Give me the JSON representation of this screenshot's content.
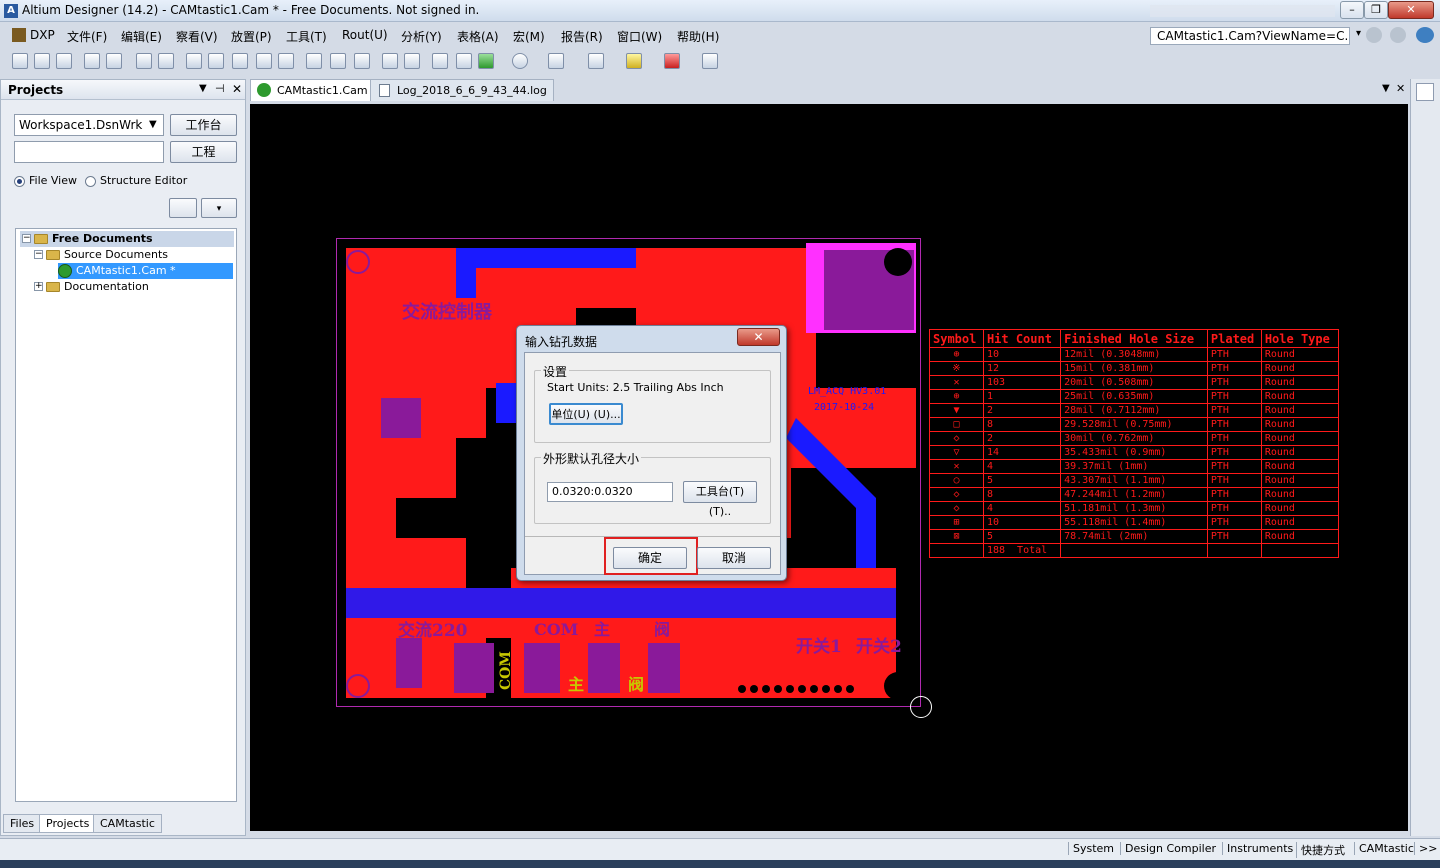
{
  "window": {
    "title": "Altium Designer (14.2) - CAMtastic1.Cam * - Free Documents. Not signed in."
  },
  "menu": [
    "DXP",
    "文件(F)",
    "编辑(E)",
    "察看(V)",
    "放置(P)",
    "工具(T)",
    "Rout(U)",
    "分析(Y)",
    "表格(A)",
    "宏(M)",
    "报告(R)",
    "窗口(W)",
    "帮助(H)"
  ],
  "address": {
    "value": "CAMtastic1.Cam?ViewName=C..."
  },
  "panel": {
    "title": "Projects",
    "workspace": "Workspace1.DsnWrk",
    "workspace_btn": "工作台",
    "project_btn": "工程",
    "radio_file_view": "File View",
    "radio_structure": "Structure Editor",
    "tree": {
      "root": "Free Documents",
      "source": "Source Documents",
      "file": "CAMtastic1.Cam *",
      "docs": "Documentation"
    },
    "tabs": [
      "Files",
      "Projects",
      "CAMtastic"
    ]
  },
  "doctabs": [
    "CAMtastic1.Cam *",
    "Log_2018_6_6_9_43_44.log"
  ],
  "drill_table": {
    "headers": [
      "Symbol",
      "Hit Count",
      "Finished Hole Size",
      "Plated",
      "Hole Type"
    ],
    "rows": [
      [
        "⊕",
        "10",
        "12mil (0.3048mm)",
        "PTH",
        "Round"
      ],
      [
        "※",
        "12",
        "15mil (0.381mm)",
        "PTH",
        "Round"
      ],
      [
        "✕",
        "103",
        "20mil (0.508mm)",
        "PTH",
        "Round"
      ],
      [
        "⊕",
        "1",
        "25mil (0.635mm)",
        "PTH",
        "Round"
      ],
      [
        "▼",
        "2",
        "28mil (0.7112mm)",
        "PTH",
        "Round"
      ],
      [
        "□",
        "8",
        "29.528mil (0.75mm)",
        "PTH",
        "Round"
      ],
      [
        "◇",
        "2",
        "30mil (0.762mm)",
        "PTH",
        "Round"
      ],
      [
        "▽",
        "14",
        "35.433mil (0.9mm)",
        "PTH",
        "Round"
      ],
      [
        "✕",
        "4",
        "39.37mil (1mm)",
        "PTH",
        "Round"
      ],
      [
        "○",
        "5",
        "43.307mil (1.1mm)",
        "PTH",
        "Round"
      ],
      [
        "◇",
        "8",
        "47.244mil (1.2mm)",
        "PTH",
        "Round"
      ],
      [
        "◇",
        "4",
        "51.181mil (1.3mm)",
        "PTH",
        "Round"
      ],
      [
        "⊞",
        "10",
        "55.118mil (1.4mm)",
        "PTH",
        "Round"
      ],
      [
        "⊠",
        "5",
        "78.74mil (2mm)",
        "PTH",
        "Round"
      ]
    ],
    "total_count": "188",
    "total_label": "Total"
  },
  "pcb_labels": {
    "title_cn": "交流控制器",
    "board_id": "LM_ACQ HV3.01",
    "date": "2017-10-24",
    "ac220": "交流220",
    "com": "COM",
    "main": "主",
    "valve": "阀",
    "switch1": "开关1",
    "switch2": "开关2",
    "com_v": "COM"
  },
  "dialog": {
    "title": "输入钻孔数据",
    "group1": "设置",
    "start_units": "Start Units: 2.5 Trailing Abs Inch",
    "units_btn": "单位(U) (U)...",
    "group2": "外形默认孔径大小",
    "size_value": "0.0320:0.0320",
    "tool_btn": "工具台(T) (T)..",
    "ok": "确定",
    "cancel": "取消"
  },
  "status": [
    "System",
    "Design Compiler",
    "Instruments",
    "快捷方式",
    "CAMtastic",
    ">>"
  ],
  "colors": {
    "pcb_red": "#ff1a1a",
    "pcb_blue": "#1a1aff",
    "pcb_purple": "#8a1a9a",
    "canvas": "#000000",
    "highlight": "#e02020"
  }
}
